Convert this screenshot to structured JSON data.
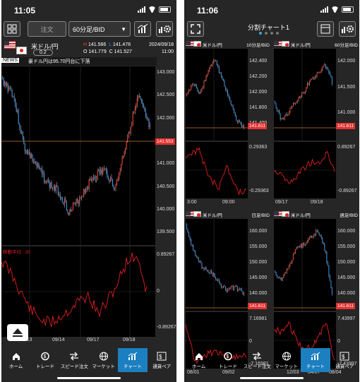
{
  "left": {
    "status_time": "11:05",
    "order_label": "注文",
    "timeframe": "60分足/BID",
    "pair": "米ドル/円",
    "spread": "0.2",
    "ohlc": {
      "H": "141.566",
      "L": "141.476",
      "O": "141.779",
      "C": "141.527"
    },
    "ohlc_labels": {
      "H": "H",
      "L": "L",
      "O": "O",
      "C": "C"
    },
    "date": "2024/09/18",
    "time": "11:00",
    "news_tag": "NEWS",
    "news_text": "豪ドル円は95.70円台に下落",
    "price_axis": [
      "143.000",
      "142.500",
      "142.000",
      "141.500",
      "141.000",
      "140.500",
      "140.000",
      "139.500"
    ],
    "current_price": "141.553",
    "indicator_label": "移動平均 : 20",
    "indicator_axis": [
      "0.89267",
      "0",
      "-0.89267"
    ],
    "x_labels": [
      "09/13",
      "09/14",
      "09/17",
      "09/18"
    ]
  },
  "right": {
    "status_time": "11:06",
    "title": "分割チャート1",
    "panels": [
      {
        "pair": "米ドル/円",
        "tf": "10分足/BID",
        "price_axis": [
          "142.400",
          "142.200",
          "142.000",
          "141.800",
          "141.400"
        ],
        "price": "141.611",
        "ind_axis": [
          "0.29363",
          "-0.29363"
        ],
        "x_labels": [
          "3:00",
          "09:00"
        ]
      },
      {
        "pair": "米ドル/円",
        "tf": "60分足/BID",
        "price_axis": [
          "142.000",
          "141.500",
          "141.000"
        ],
        "price": "141.611",
        "ind_axis": [
          "0.89267",
          "-0.89267"
        ],
        "x_labels": [
          "09/17",
          "09/18"
        ]
      },
      {
        "pair": "米ドル/円",
        "tf": "日足/BID",
        "price_axis": [
          "160.000",
          "155.000",
          "150.000",
          "145.000",
          "140.000"
        ],
        "price": "141.611",
        "ind_axis": [
          "7.16981",
          "0",
          "-7.16981"
        ],
        "x_labels": [
          "08/01",
          "09/02"
        ]
      },
      {
        "pair": "米ドル/円",
        "tf": "週足/BID",
        "price_axis": [
          "160.000",
          "155.000",
          "150.000",
          "145.000",
          "140.000"
        ],
        "price": "141.611",
        "ind_axis": [
          "7.43997",
          "0",
          "-7.43997"
        ],
        "x_labels": [
          "12/03",
          "04/07",
          "08/04"
        ]
      }
    ]
  },
  "tabs": [
    "ホーム",
    "トレード",
    "スピード注文",
    "マーケット",
    "チャート",
    "通貨ペア"
  ],
  "active_tab": "チャート",
  "colors": {
    "up": "#e8412c",
    "down": "#3a8fd9",
    "indicator": "#e02020",
    "price_line": "#c47a2e",
    "accent": "#1c7fbf"
  }
}
